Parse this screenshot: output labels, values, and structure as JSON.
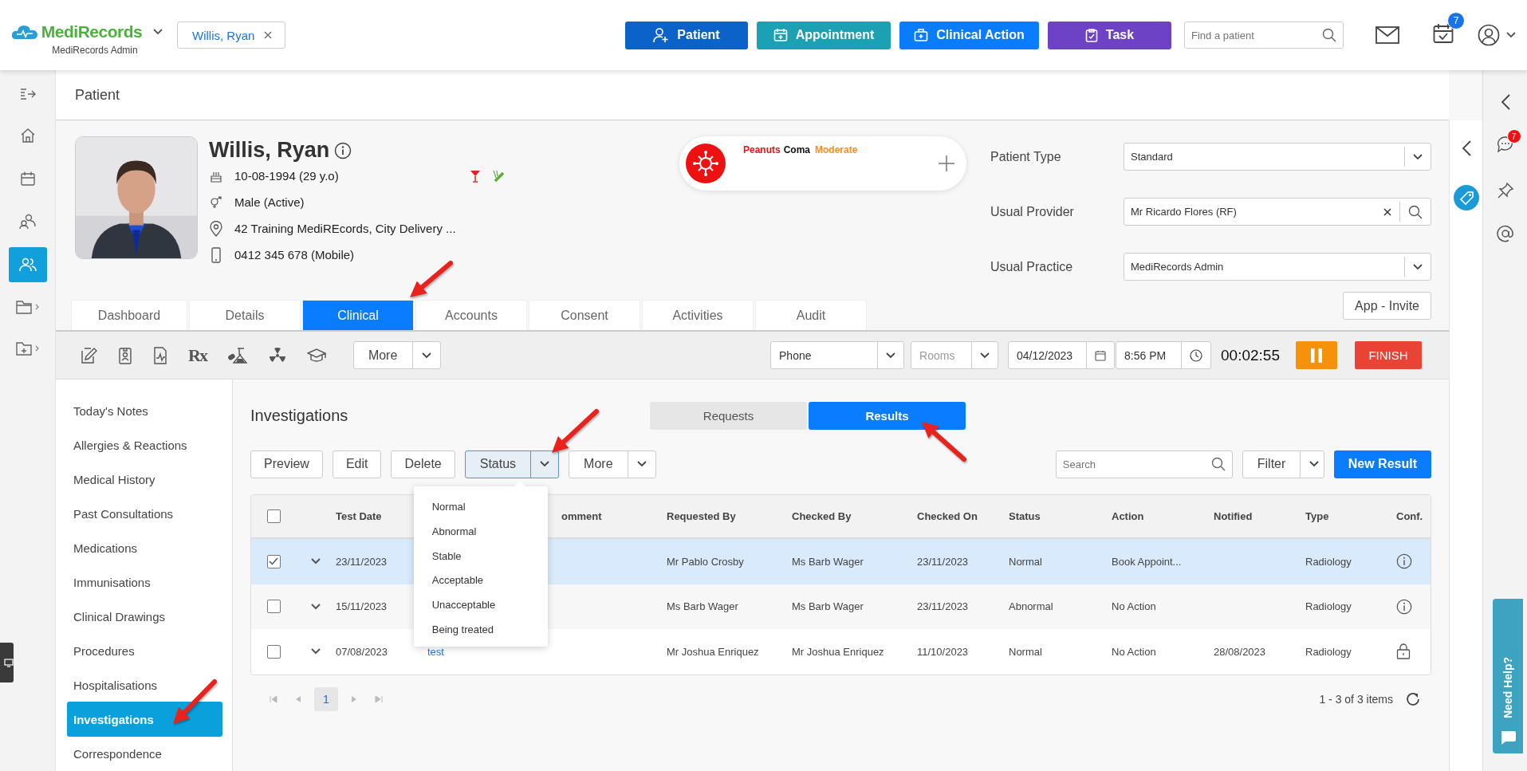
{
  "header": {
    "app_name": "MediRecords",
    "practice": "MediRecords Admin",
    "patient_tab": "Willis, Ryan",
    "actions": [
      {
        "label": "Patient",
        "kind": "patient"
      },
      {
        "label": "Appointment",
        "kind": "appointment"
      },
      {
        "label": "Clinical Action",
        "kind": "clinical"
      },
      {
        "label": "Task",
        "kind": "task"
      }
    ],
    "search": {
      "placeholder": "Find a patient"
    },
    "tasks_badge": "7"
  },
  "page_title": "Patient",
  "patient": {
    "name": "Willis, Ryan",
    "dob": "10-08-1994 (29 y.o)",
    "gender": "Male (Active)",
    "address": "42 Training MediREcords, City Delivery ...",
    "phone": "0412 345 678 (Mobile)",
    "allergy": {
      "substance": "Peanuts",
      "reaction": "Coma",
      "severity": "Moderate"
    },
    "fields": [
      {
        "label": "Patient Type",
        "value": "Standard",
        "kind": "select"
      },
      {
        "label": "Usual Provider",
        "value": "Mr Ricardo Flores (RF)",
        "kind": "lookup"
      },
      {
        "label": "Usual Practice",
        "value": "MediRecords Admin",
        "kind": "select"
      }
    ],
    "invite_button": "App - Invite"
  },
  "tabs": [
    {
      "label": "Dashboard",
      "selected": false
    },
    {
      "label": "Details",
      "selected": false
    },
    {
      "label": "Clinical",
      "selected": true
    },
    {
      "label": "Accounts",
      "selected": false
    },
    {
      "label": "Consent",
      "selected": false
    },
    {
      "label": "Activities",
      "selected": false
    },
    {
      "label": "Audit",
      "selected": false
    }
  ],
  "toolbar": {
    "rx": "Rx",
    "more": "More",
    "mode": "Phone",
    "room": {
      "placeholder": "Rooms"
    },
    "date": "04/12/2023",
    "time": "8:56 PM",
    "timer": "00:02:55",
    "finish": "FINISH"
  },
  "menu": [
    {
      "label": "Today's Notes",
      "selected": false
    },
    {
      "label": "Allergies & Reactions",
      "selected": false
    },
    {
      "label": "Medical History",
      "selected": false
    },
    {
      "label": "Past Consultations",
      "selected": false
    },
    {
      "label": "Medications",
      "selected": false
    },
    {
      "label": "Immunisations",
      "selected": false
    },
    {
      "label": "Clinical Drawings",
      "selected": false
    },
    {
      "label": "Procedures",
      "selected": false
    },
    {
      "label": "Hospitalisations",
      "selected": false
    },
    {
      "label": "Investigations",
      "selected": true
    },
    {
      "label": "Correspondence",
      "selected": false
    }
  ],
  "investigations": {
    "title": "Investigations",
    "views": [
      {
        "label": "Requests",
        "selected": false
      },
      {
        "label": "Results",
        "selected": true
      }
    ],
    "actions": [
      "Preview",
      "Edit",
      "Delete"
    ],
    "status_button": "Status",
    "more_button": "More",
    "status_menu": [
      "Normal",
      "Abnormal",
      "Stable",
      "Acceptable",
      "Unacceptable",
      "Being treated"
    ],
    "search": {
      "placeholder": "Search"
    },
    "filter": "Filter",
    "new_button": "New Result",
    "table": {
      "all_selected": false,
      "columns": {
        "test_date": "Test Date",
        "comment": "omment",
        "requested_by": "Requested By",
        "checked_by": "Checked By",
        "checked_on": "Checked On",
        "status": "Status",
        "action": "Action",
        "notified": "Notified",
        "type": "Type",
        "conf": "Conf."
      },
      "rows": [
        {
          "selected": true,
          "test_date": "23/11/2023",
          "requested_by": "Mr Pablo Crosby",
          "checked_by": "Ms Barb Wager",
          "checked_on": "23/11/2023",
          "status": "Normal",
          "action": "Book Appoint...",
          "type": "Radiology",
          "locked": false
        },
        {
          "selected": false,
          "test_date": "15/11/2023",
          "requested_by": "Ms Barb Wager",
          "checked_by": "Ms Barb Wager",
          "checked_on": "23/11/2023",
          "status": "Abnormal",
          "action": "No Action",
          "type": "Radiology",
          "locked": false
        },
        {
          "selected": false,
          "test_date": "07/08/2023",
          "column_3": "test",
          "requested_by": "Mr Joshua Enriquez",
          "checked_by": "Mr Joshua Enriquez",
          "checked_on": "11/10/2023",
          "status": "Normal",
          "action": "No Action",
          "notified": "28/08/2023",
          "type": "Radiology",
          "locked": true
        }
      ]
    },
    "pagination": {
      "pages": [
        {
          "label": "1",
          "selected": true
        }
      ],
      "summary": "1 - 3 of 3 items"
    }
  },
  "rail_badge": "7",
  "help_tab": "Need Help?"
}
